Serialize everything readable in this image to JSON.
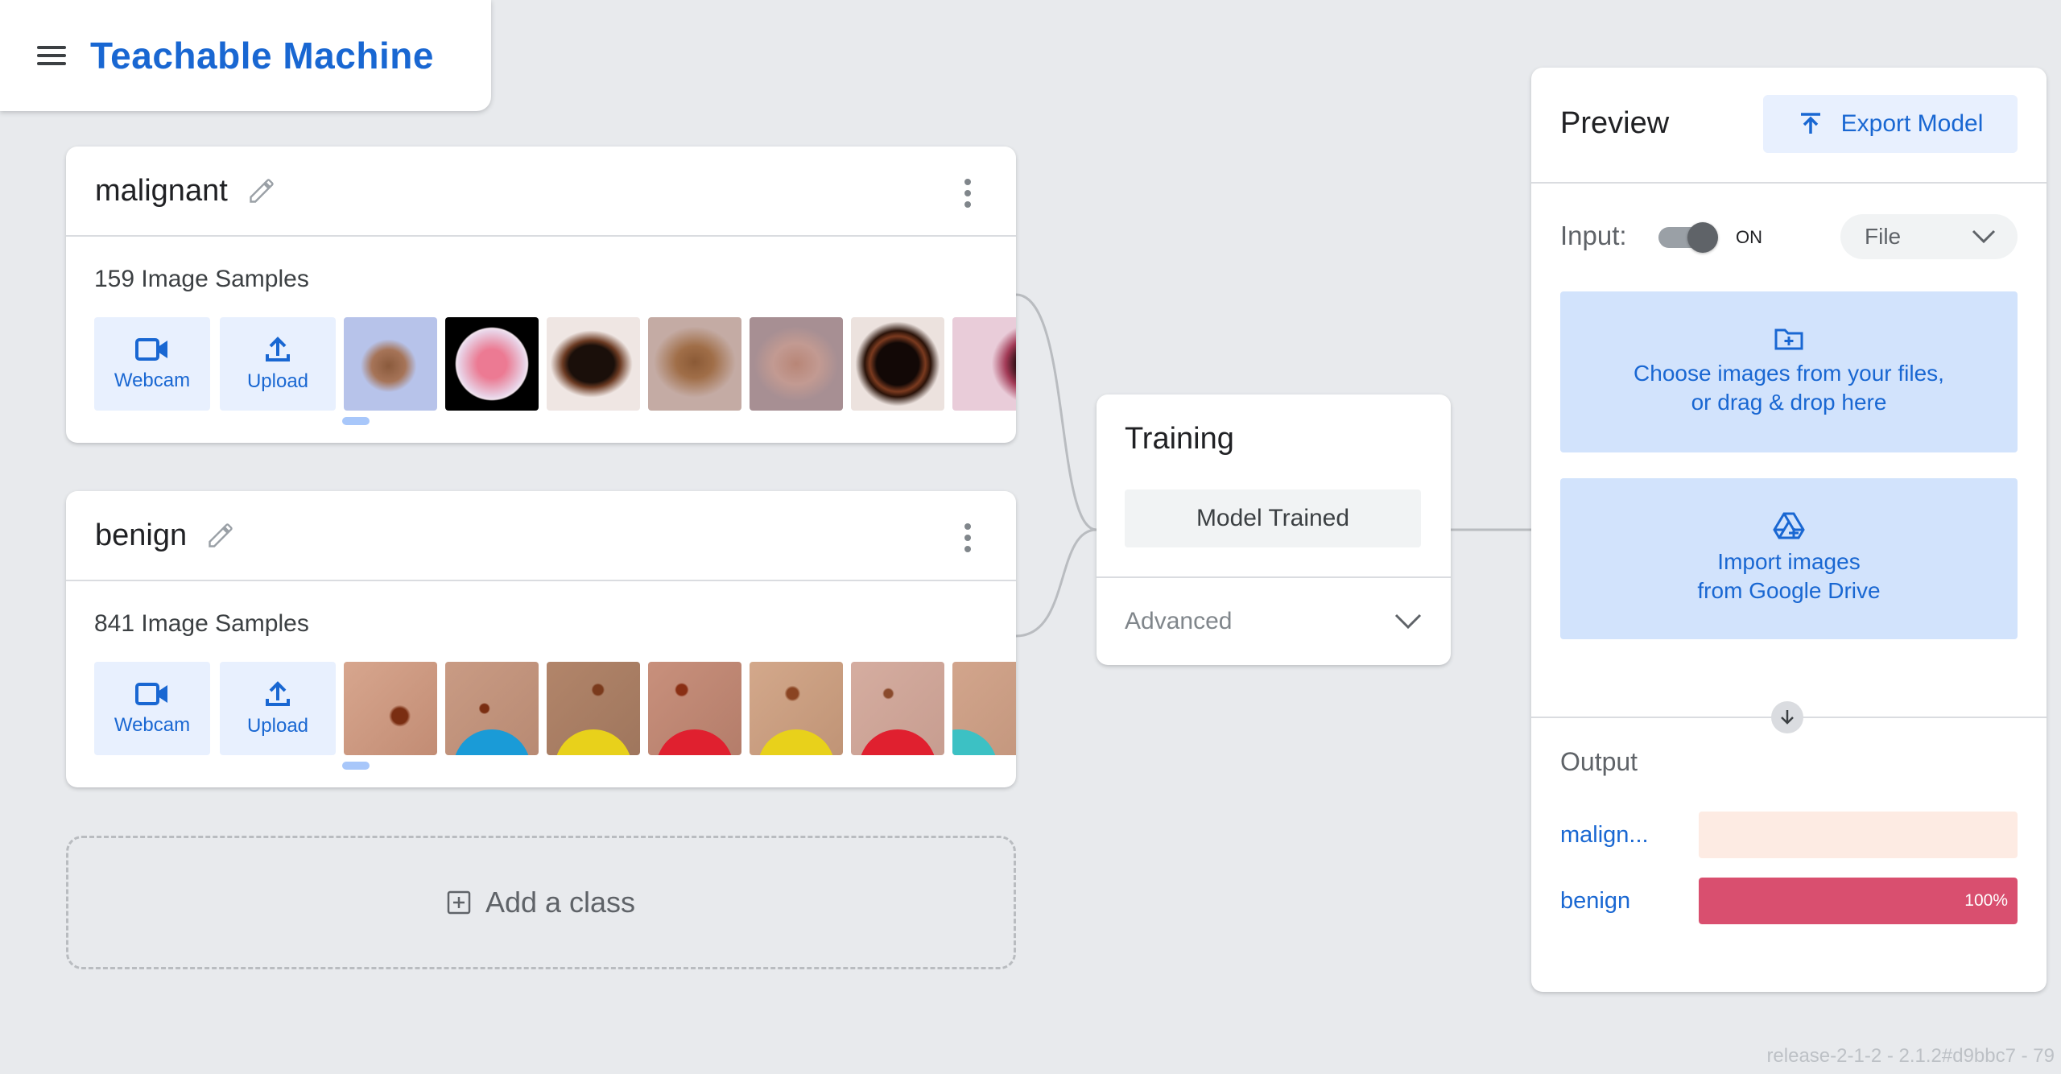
{
  "app": {
    "title": "Teachable Machine"
  },
  "classes": [
    {
      "name": "malignant",
      "samples_label": "159 Image Samples",
      "webcam_label": "Webcam",
      "upload_label": "Upload"
    },
    {
      "name": "benign",
      "samples_label": "841 Image Samples",
      "webcam_label": "Webcam",
      "upload_label": "Upload"
    }
  ],
  "add_class": {
    "label": "Add a class"
  },
  "training": {
    "title": "Training",
    "button_label": "Model Trained",
    "advanced_label": "Advanced"
  },
  "preview": {
    "title": "Preview",
    "export_label": "Export Model",
    "input_label": "Input:",
    "toggle_state": "ON",
    "input_source": "File",
    "file_drop_line1": "Choose images from your files,",
    "file_drop_line2": "or drag & drop here",
    "drive_line1": "Import images",
    "drive_line2": "from Google Drive",
    "output_title": "Output",
    "outputs": [
      {
        "label": "malign...",
        "value": 0,
        "percent_text": "",
        "color": "#d94f6f",
        "track_color": "#fdebe3"
      },
      {
        "label": "benign",
        "value": 1.0,
        "percent_text": "100%",
        "color": "#d94f6f",
        "track_color": "#fdebe3"
      }
    ]
  },
  "footer": {
    "release": "release-2-1-2 - 2.1.2#d9bbc7 - 79"
  },
  "colors": {
    "accent": "#1967d2",
    "background": "#e8eaed",
    "button_bg": "#e8f0fe",
    "drop_bg": "#d2e3fc"
  }
}
